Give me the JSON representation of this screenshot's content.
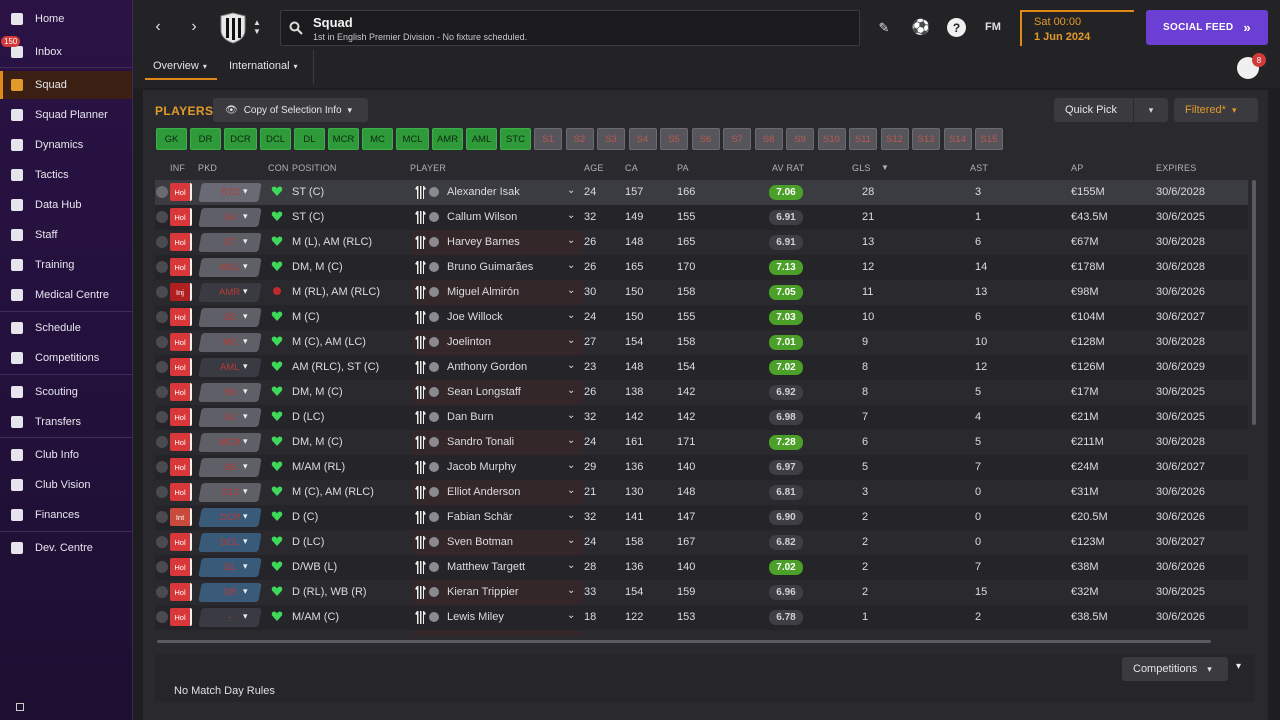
{
  "sidebar": {
    "items": [
      {
        "label": "Home",
        "icon": "home-icon"
      },
      {
        "label": "Inbox",
        "icon": "inbox-icon",
        "badge": "150"
      },
      {
        "label": "Squad",
        "icon": "shirt-icon",
        "active": true
      },
      {
        "label": "Squad Planner",
        "icon": "planner-icon"
      },
      {
        "label": "Dynamics",
        "icon": "dynamics-icon"
      },
      {
        "label": "Tactics",
        "icon": "tactics-icon"
      },
      {
        "label": "Data Hub",
        "icon": "data-hub-icon"
      },
      {
        "label": "Staff",
        "icon": "staff-icon"
      },
      {
        "label": "Training",
        "icon": "training-icon"
      },
      {
        "label": "Medical Centre",
        "icon": "medical-icon"
      },
      {
        "label": "Schedule",
        "icon": "calendar-icon"
      },
      {
        "label": "Competitions",
        "icon": "trophy-icon"
      },
      {
        "label": "Scouting",
        "icon": "scouting-icon"
      },
      {
        "label": "Transfers",
        "icon": "transfers-icon"
      },
      {
        "label": "Club Info",
        "icon": "shield-icon"
      },
      {
        "label": "Club Vision",
        "icon": "vision-icon"
      },
      {
        "label": "Finances",
        "icon": "finances-icon"
      },
      {
        "label": "Dev. Centre",
        "icon": "dev-centre-icon"
      }
    ]
  },
  "header": {
    "title": "Squad",
    "subtitle": "1st in English Premier Division - No fixture scheduled.",
    "tabs": [
      "Overview",
      "International"
    ],
    "date_day": "Sat 00:00",
    "date": "1 Jun 2024",
    "social_label": "SOCIAL FEED",
    "fm_label": "FM",
    "notif_count": "8"
  },
  "toolbar": {
    "players_label": "PLAYERS",
    "selection_label": "Copy of Selection Info",
    "quick_pick": "Quick Pick",
    "filtered": "Filtered*"
  },
  "positions": {
    "on": [
      "GK",
      "DR",
      "DCR",
      "DCL",
      "DL",
      "MCR",
      "MC",
      "MCL",
      "AMR",
      "AML",
      "STC"
    ],
    "off": [
      "S1",
      "S2",
      "S3",
      "S4",
      "S5",
      "S6",
      "S7",
      "S8",
      "S9",
      "S10",
      "S11",
      "S12",
      "S13",
      "S14",
      "S15"
    ]
  },
  "columns": [
    "INF",
    "PKD",
    "CON",
    "POSITION",
    "PLAYER",
    "AGE",
    "CA",
    "PA",
    "AV RAT",
    "GLS",
    "AST",
    "AP",
    "EXPIRES"
  ],
  "rows": [
    {
      "inf": "Hol",
      "pkd": "STC",
      "pkdc": "red",
      "pos": "ST (C)",
      "name": "Alexander Isak",
      "age": "24",
      "ca": "157",
      "pa": "166",
      "rat": "7.06",
      "good": true,
      "gls": "28",
      "ast": "3",
      "ap": "€155M",
      "exp": "30/6/2028"
    },
    {
      "inf": "Hol",
      "pkd": "S4",
      "pkdc": "grey",
      "pos": "ST (C)",
      "name": "Callum Wilson",
      "age": "32",
      "ca": "149",
      "pa": "155",
      "rat": "6.91",
      "good": false,
      "gls": "21",
      "ast": "1",
      "ap": "€43.5M",
      "exp": "30/6/2025"
    },
    {
      "inf": "Hol",
      "pkd": "S7",
      "pkdc": "grey",
      "pos": "M (L), AM (RLC)",
      "name": "Harvey Barnes",
      "age": "26",
      "ca": "148",
      "pa": "165",
      "rat": "6.91",
      "good": false,
      "gls": "13",
      "ast": "6",
      "ap": "€67M",
      "exp": "30/6/2028"
    },
    {
      "inf": "Hol",
      "pkd": "MCL",
      "pkdc": "grey",
      "pos": "DM, M (C)",
      "name": "Bruno Guimarães",
      "age": "26",
      "ca": "165",
      "pa": "170",
      "rat": "7.13",
      "good": true,
      "gls": "12",
      "ast": "14",
      "ap": "€178M",
      "exp": "30/6/2028"
    },
    {
      "inf": "Inj",
      "pkd": "AMR",
      "pkdc": "none",
      "pos": "M (RL), AM (RLC)",
      "name": "Miguel Almirón",
      "age": "30",
      "ca": "150",
      "pa": "158",
      "rat": "7.05",
      "good": true,
      "gls": "11",
      "ast": "13",
      "ap": "€98M",
      "exp": "30/6/2026"
    },
    {
      "inf": "Hol",
      "pkd": "S5",
      "pkdc": "grey",
      "pos": "M (C)",
      "name": "Joe Willock",
      "age": "24",
      "ca": "150",
      "pa": "155",
      "rat": "7.03",
      "good": true,
      "gls": "10",
      "ast": "6",
      "ap": "€104M",
      "exp": "30/6/2027"
    },
    {
      "inf": "Hol",
      "pkd": "MC",
      "pkdc": "grey",
      "pos": "M (C), AM (LC)",
      "name": "Joelinton",
      "age": "27",
      "ca": "154",
      "pa": "158",
      "rat": "7.01",
      "good": true,
      "gls": "9",
      "ast": "10",
      "ap": "€128M",
      "exp": "30/6/2028"
    },
    {
      "inf": "Hol",
      "pkd": "AML",
      "pkdc": "none",
      "pos": "AM (RLC), ST (C)",
      "name": "Anthony Gordon",
      "age": "23",
      "ca": "148",
      "pa": "154",
      "rat": "7.02",
      "good": true,
      "gls": "8",
      "ast": "12",
      "ap": "€126M",
      "exp": "30/6/2029"
    },
    {
      "inf": "Hol",
      "pkd": "S8",
      "pkdc": "grey",
      "pos": "DM, M (C)",
      "name": "Sean Longstaff",
      "age": "26",
      "ca": "138",
      "pa": "142",
      "rat": "6.92",
      "good": false,
      "gls": "8",
      "ast": "5",
      "ap": "€17M",
      "exp": "30/6/2025"
    },
    {
      "inf": "Hol",
      "pkd": "S2",
      "pkdc": "grey",
      "pos": "D (LC)",
      "name": "Dan Burn",
      "age": "32",
      "ca": "142",
      "pa": "142",
      "rat": "6.98",
      "good": false,
      "gls": "7",
      "ast": "4",
      "ap": "€21M",
      "exp": "30/6/2025"
    },
    {
      "inf": "Hol",
      "pkd": "MCR",
      "pkdc": "grey",
      "pos": "DM, M (C)",
      "name": "Sandro Tonali",
      "age": "24",
      "ca": "161",
      "pa": "171",
      "rat": "7.28",
      "good": true,
      "gls": "6",
      "ast": "5",
      "ap": "€211M",
      "exp": "30/6/2028"
    },
    {
      "inf": "Hol",
      "pkd": "S6",
      "pkdc": "grey",
      "pos": "M/AM (RL)",
      "name": "Jacob Murphy",
      "age": "29",
      "ca": "136",
      "pa": "140",
      "rat": "6.97",
      "good": false,
      "gls": "5",
      "ast": "7",
      "ap": "€24M",
      "exp": "30/6/2027"
    },
    {
      "inf": "Hol",
      "pkd": "S12",
      "pkdc": "grey",
      "pos": "M (C), AM (RLC)",
      "name": "Elliot Anderson",
      "age": "21",
      "ca": "130",
      "pa": "148",
      "rat": "6.81",
      "good": false,
      "gls": "3",
      "ast": "0",
      "ap": "€31M",
      "exp": "30/6/2026"
    },
    {
      "inf": "Int",
      "pkd": "DCR",
      "pkdc": "blue",
      "pos": "D (C)",
      "name": "Fabian Schär",
      "age": "32",
      "ca": "141",
      "pa": "147",
      "rat": "6.90",
      "good": false,
      "gls": "2",
      "ast": "0",
      "ap": "€20.5M",
      "exp": "30/6/2026"
    },
    {
      "inf": "Hol",
      "pkd": "DCL",
      "pkdc": "blue",
      "pos": "D (LC)",
      "name": "Sven Botman",
      "age": "24",
      "ca": "158",
      "pa": "167",
      "rat": "6.82",
      "good": false,
      "gls": "2",
      "ast": "0",
      "ap": "€123M",
      "exp": "30/6/2027"
    },
    {
      "inf": "Hol",
      "pkd": "DL",
      "pkdc": "blue",
      "pos": "D/WB (L)",
      "name": "Matthew Targett",
      "age": "28",
      "ca": "136",
      "pa": "140",
      "rat": "7.02",
      "good": true,
      "gls": "2",
      "ast": "7",
      "ap": "€38M",
      "exp": "30/6/2026"
    },
    {
      "inf": "Hol",
      "pkd": "DR",
      "pkdc": "blue",
      "pos": "D (RL), WB (R)",
      "name": "Kieran Trippier",
      "age": "33",
      "ca": "154",
      "pa": "159",
      "rat": "6.96",
      "good": false,
      "gls": "2",
      "ast": "15",
      "ap": "€32M",
      "exp": "30/6/2025"
    },
    {
      "inf": "Hol",
      "pkd": "-",
      "pkdc": "none",
      "pos": "M/AM (C)",
      "name": "Lewis Miley",
      "age": "18",
      "ca": "122",
      "pa": "153",
      "rat": "6.78",
      "good": false,
      "gls": "1",
      "ast": "2",
      "ap": "€38.5M",
      "exp": "30/6/2026"
    }
  ],
  "footer": {
    "competitions": "Competitions",
    "no_rules": "No Match Day Rules"
  },
  "colors": {
    "accent": "#e39a2a",
    "social": "#6b3fd4",
    "good_rating": "#4aa028",
    "injury": "#d8383a"
  }
}
